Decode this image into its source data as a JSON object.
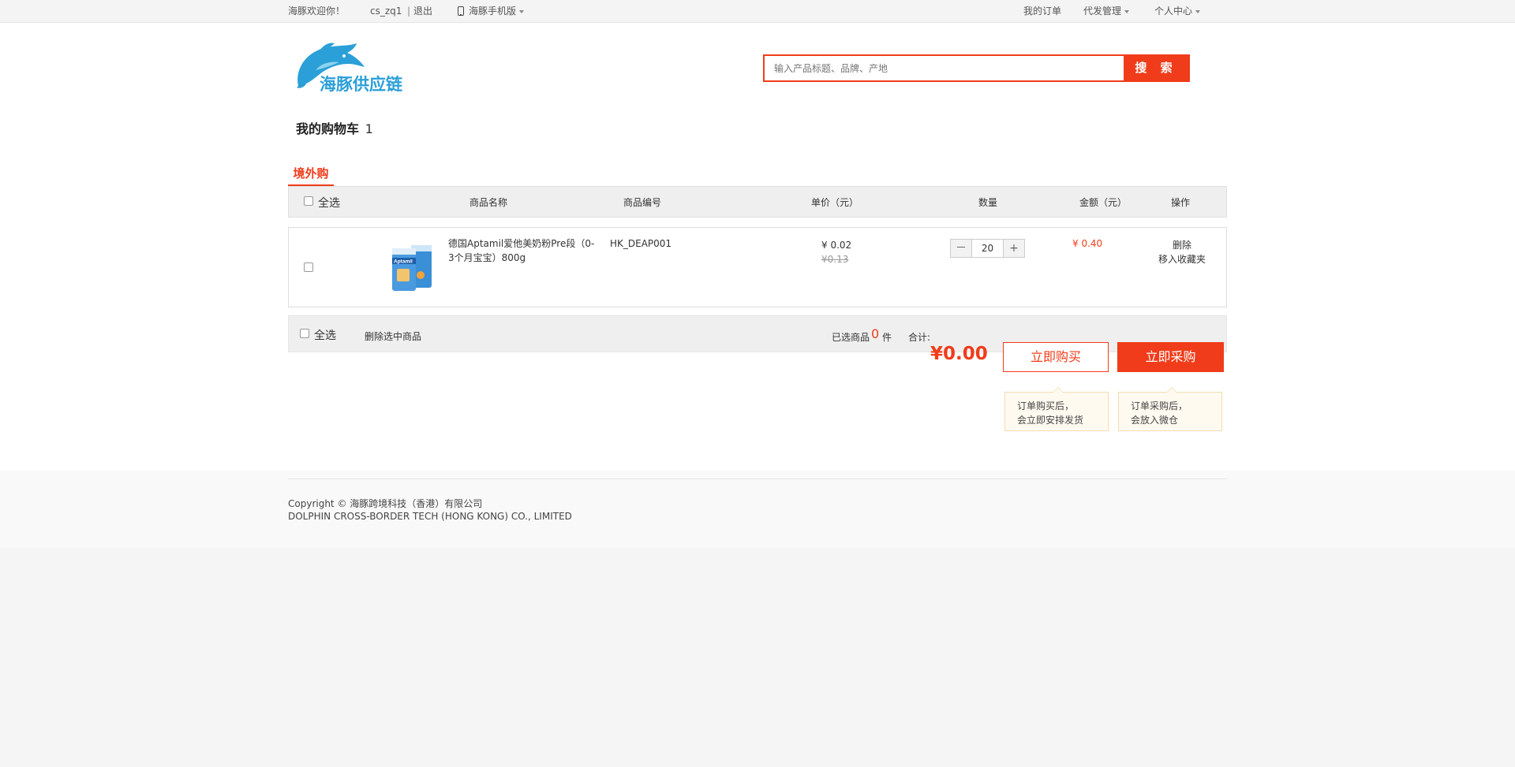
{
  "topbar": {
    "welcome": "海豚欢迎你！",
    "username": "cs_zq1",
    "separator": "|",
    "logout": "退出",
    "mobile": "海豚手机版",
    "my_orders": "我的订单",
    "dropship": "代发管理",
    "personal_center": "个人中心"
  },
  "header": {
    "brand": "海豚供应链",
    "search_placeholder": "输入产品标题、品牌、产地",
    "search_button": "搜 索"
  },
  "cart": {
    "title": "我的购物车",
    "count": "1",
    "tab": "境外购",
    "columns": {
      "select_all": "全选",
      "name": "商品名称",
      "code": "商品编号",
      "unit_price": "单价（元）",
      "quantity": "数量",
      "amount": "金额（元）",
      "action": "操作"
    },
    "items": [
      {
        "name_line1": "德国Aptamil爱他美奶粉Pre段（0-",
        "name_line2": "3个月宝宝）800g",
        "image_label": "Aptamil",
        "code": "HK_DEAP001",
        "price": "¥ 0.02",
        "original_price": "¥0.13",
        "minus": "－",
        "quantity": "20",
        "plus": "+",
        "amount": "¥ 0.40",
        "delete": "删除",
        "move_to_favorites": "移入收藏夹"
      }
    ]
  },
  "footer_bar": {
    "select_all": "全选",
    "delete_selected": "删除选中商品",
    "selected_label": "已选商品",
    "selected_count": "0",
    "selected_unit": "件",
    "total_label": "合计:",
    "total": "¥0.00",
    "buy_now": "立即购买",
    "purchase_now": "立即采购",
    "tip_buy_line1": "订单购买后，",
    "tip_buy_line2": "会立即安排发货",
    "tip_purchase_line1": "订单采购后，",
    "tip_purchase_line2": "会放入微仓"
  },
  "footer": {
    "copyright": "Copyright ©  海豚跨境科技（香港）有限公司",
    "company_en": "DOLPHIN CROSS-BORDER TECH (HONG KONG) CO., LIMITED"
  },
  "colors": {
    "accent": "#f03c1a",
    "brand_blue": "#2a9fd8"
  }
}
